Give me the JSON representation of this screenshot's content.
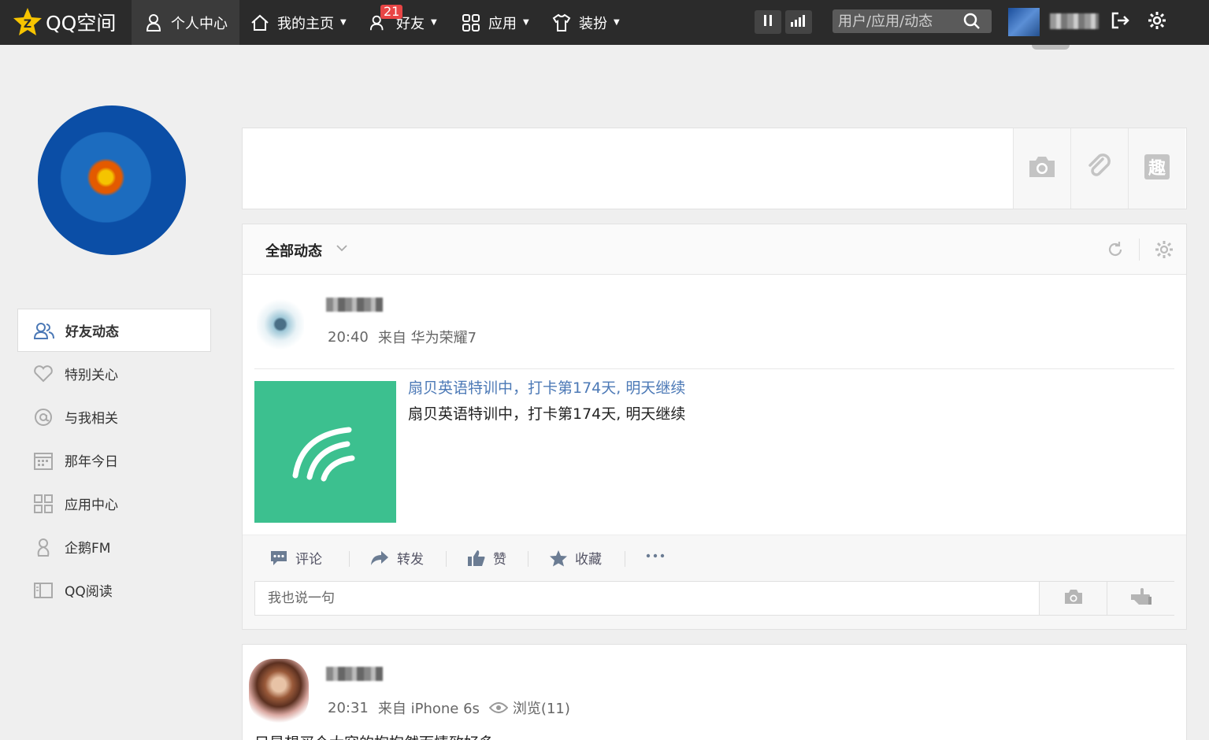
{
  "topbar": {
    "logo_text": "QQ空间",
    "nav": [
      {
        "label": "个人中心"
      },
      {
        "label": "我的主页"
      },
      {
        "label": "好友",
        "badge": "21"
      },
      {
        "label": "应用"
      },
      {
        "label": "装扮"
      }
    ],
    "search_placeholder": "用户/应用/动态"
  },
  "sidebar": {
    "items": [
      {
        "label": "好友动态",
        "icon": "friends-icon"
      },
      {
        "label": "特别关心",
        "icon": "heart-icon"
      },
      {
        "label": "与我相关",
        "icon": "at-icon"
      },
      {
        "label": "那年今日",
        "icon": "calendar-icon"
      },
      {
        "label": "应用中心",
        "icon": "apps-icon"
      },
      {
        "label": "企鹅FM",
        "icon": "penguin-icon"
      },
      {
        "label": "QQ阅读",
        "icon": "book-icon"
      }
    ]
  },
  "feed": {
    "title": "全部动态",
    "posts": [
      {
        "time": "20:40",
        "source": "来自 华为荣耀7",
        "share_title": "扇贝英语特训中，打卡第174天, 明天继续",
        "share_desc": "扇贝英语特训中，打卡第174天, 明天继续",
        "thumb_color": "#3cc08f",
        "actions": [
          "评论",
          "转发",
          "赞",
          "收藏"
        ],
        "comment_placeholder": "我也说一句"
      },
      {
        "time": "20:31",
        "source": "来自 iPhone 6s",
        "views": "浏览(11)",
        "text": "只是想买个大容的抱抱然而情致好多"
      }
    ]
  },
  "colors": {
    "topbar": "#2b2b2b",
    "badge": "#e84545",
    "link": "#4c79b6",
    "accent_green": "#3cc08f"
  }
}
